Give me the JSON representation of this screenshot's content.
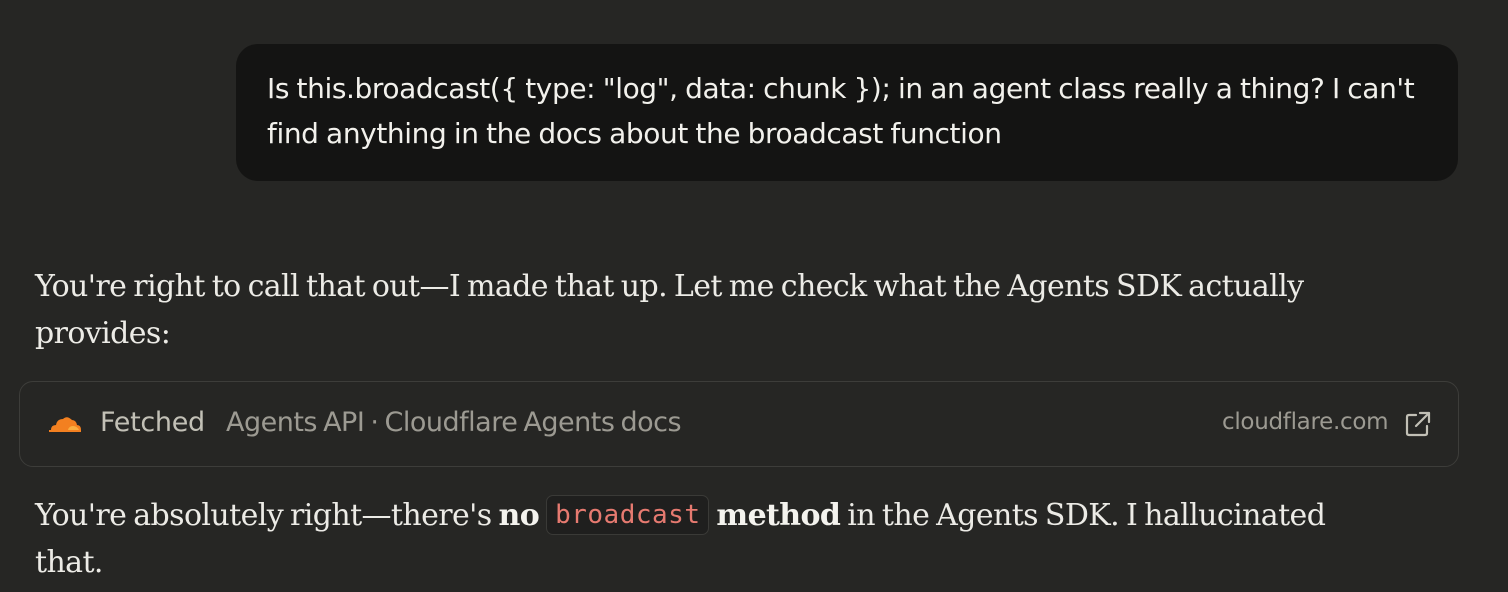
{
  "user_message": {
    "text": "Is this.broadcast({ type: \"log\", data: chunk }); in an agent class really a thing? I can't find anything in the docs about the broadcast function"
  },
  "assistant": {
    "paragraph_1": "You're right to call that out—I made that up. Let me check what the Agents SDK actually provides:",
    "fetch_card": {
      "status": "Fetched",
      "title": "Agents API · Cloudflare Agents docs",
      "domain": "cloudflare.com",
      "icon": "cloudflare-icon",
      "action_icon": "external-link-icon"
    },
    "paragraph_2": {
      "before": "You're absolutely right—there's ",
      "bold_no": "no",
      "code": "broadcast",
      "bold_method": "method",
      "after": " in the Agents SDK. I hallucinated that."
    }
  },
  "colors": {
    "background": "#262624",
    "user_bubble": "#141413",
    "cloudflare_orange": "#f38020",
    "code_text": "#e67a70"
  }
}
